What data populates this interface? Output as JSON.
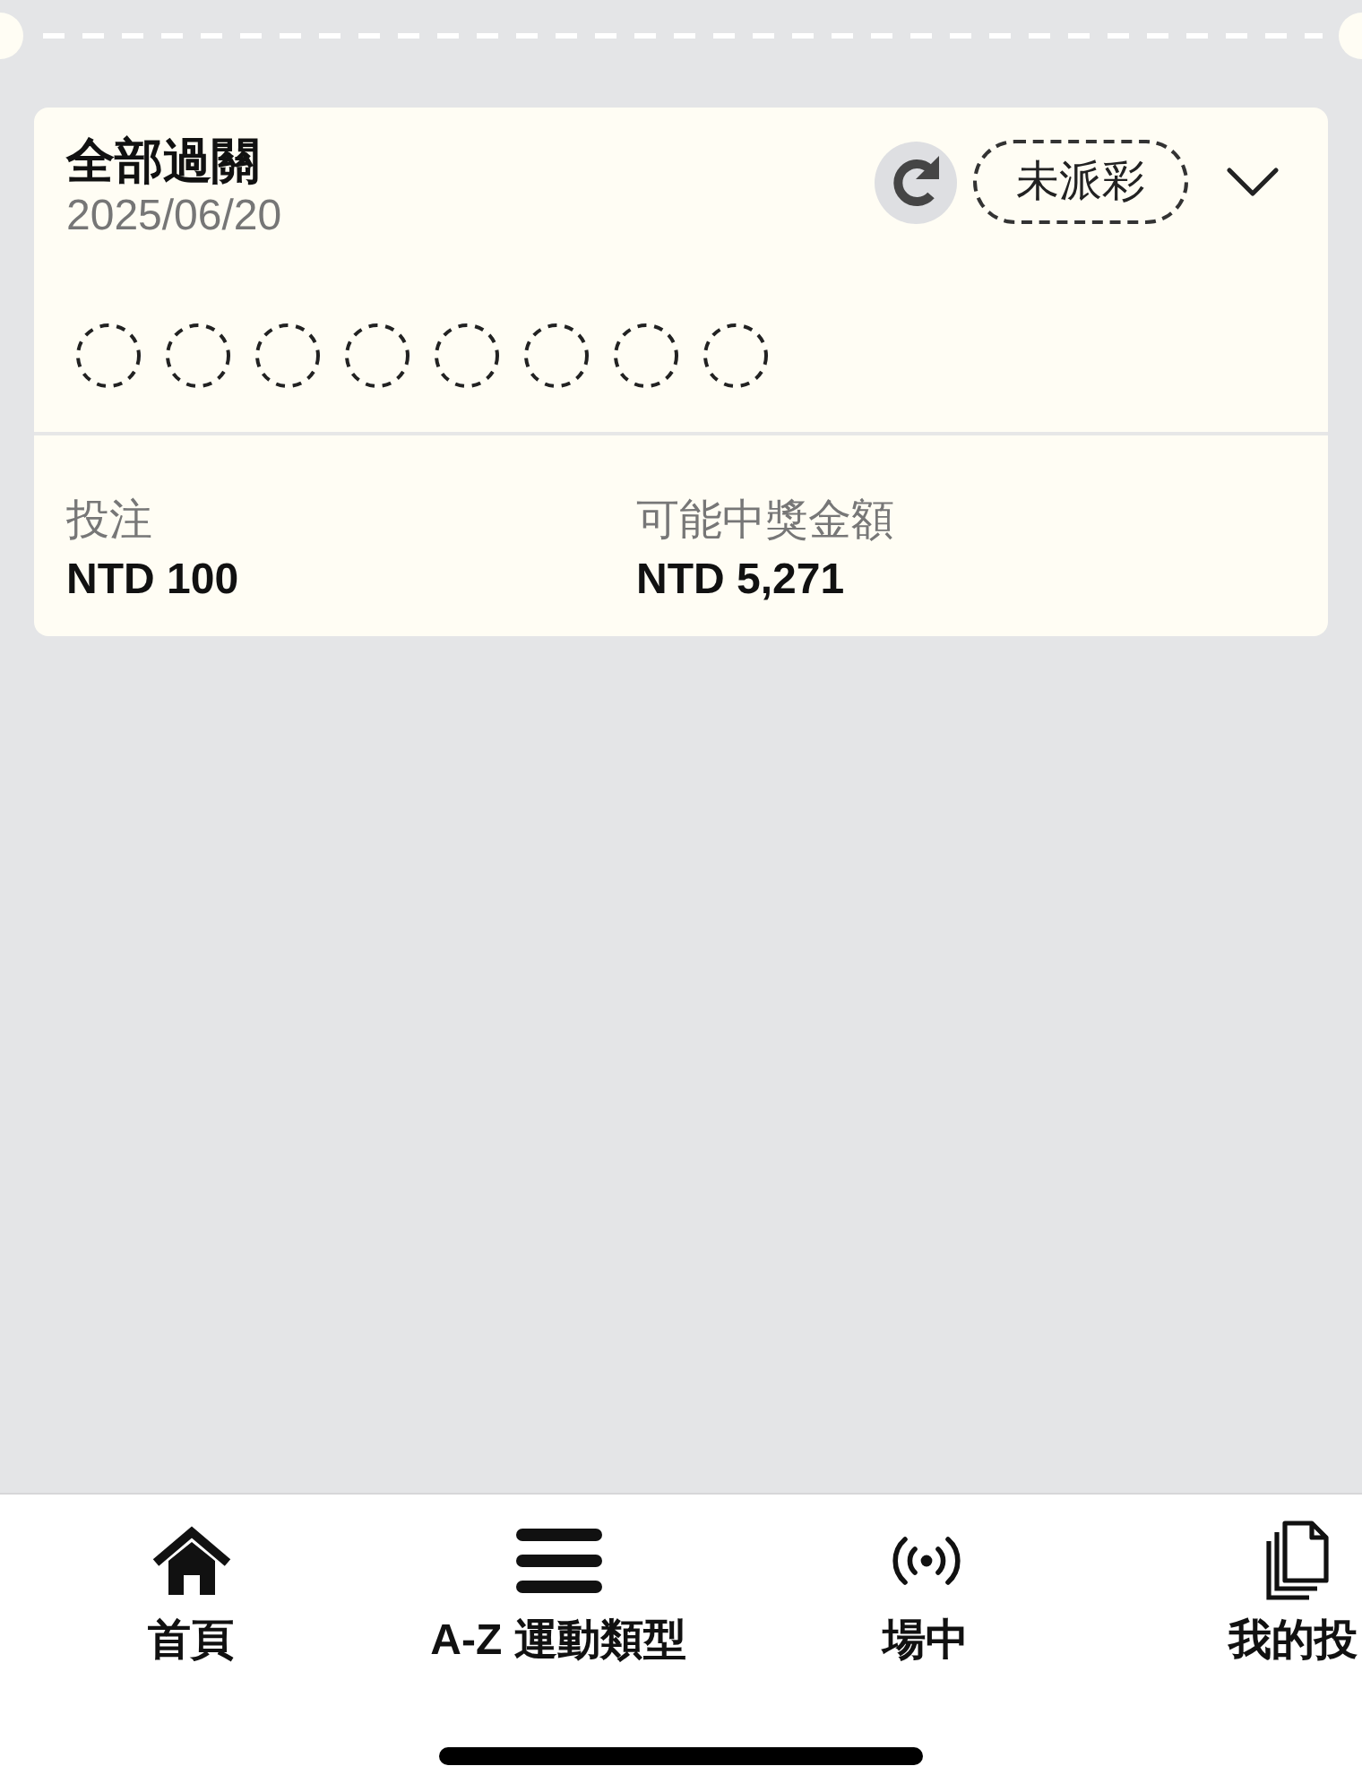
{
  "bet": {
    "title": "全部過關",
    "date": "2025/06/20",
    "status": "未派彩",
    "expanded": false,
    "legs": [
      {
        "kind": "pending"
      },
      {
        "kind": "pending"
      },
      {
        "kind": "pending"
      },
      {
        "kind": "pending"
      },
      {
        "kind": "pending"
      },
      {
        "kind": "pending"
      },
      {
        "kind": "pending"
      },
      {
        "kind": "pending"
      }
    ],
    "stake": {
      "label": "投注",
      "value": "NTD 100"
    },
    "potential_win": {
      "label": "可能中獎金額",
      "value": "NTD 5,271"
    }
  },
  "nav": {
    "items": [
      {
        "label": "首頁"
      },
      {
        "label": "A-Z 運動類型"
      },
      {
        "label": "場中"
      },
      {
        "label": "我的投"
      }
    ]
  }
}
